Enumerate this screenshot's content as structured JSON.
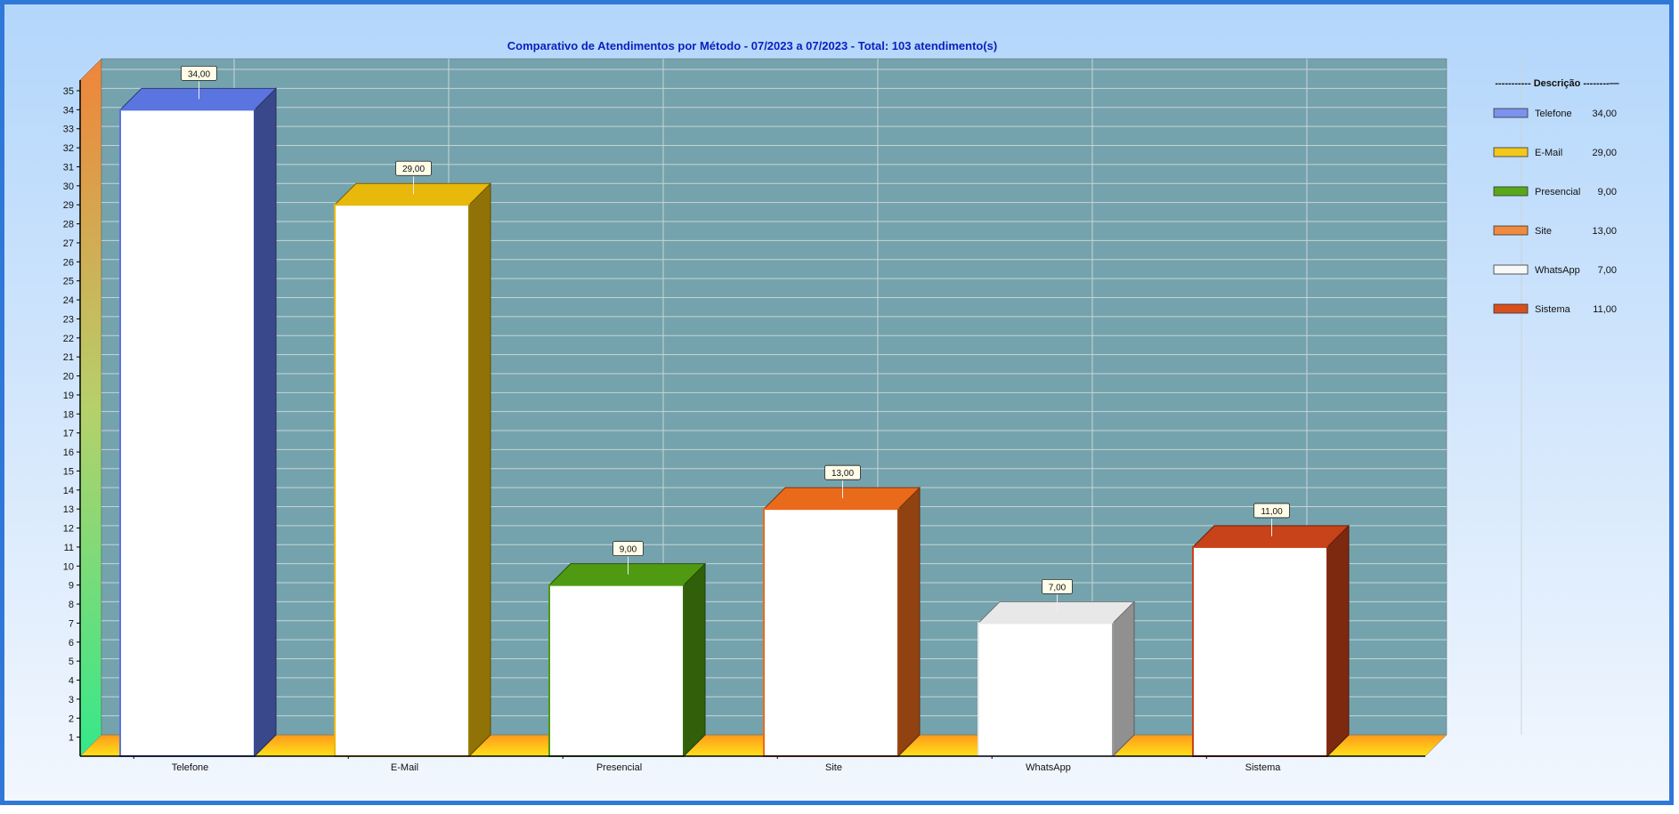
{
  "chart_data": {
    "type": "bar",
    "title": "Comparativo de Atendimentos por Método - 07/2023 a 07/2023 - Total: 103 atendimento(s)",
    "categories": [
      "Telefone",
      "E-Mail",
      "Presencial",
      "Site",
      "WhatsApp",
      "Sistema"
    ],
    "values": [
      34,
      29,
      9,
      13,
      7,
      11
    ],
    "value_labels": [
      "34,00",
      "29,00",
      "9,00",
      "13,00",
      "7,00",
      "11,00"
    ],
    "colors": [
      "#5a74e0",
      "#e8b80a",
      "#4f9a10",
      "#ea6a1c",
      "#e8e8e8",
      "#c8421a"
    ],
    "ylim": [
      0,
      35
    ],
    "yticks": [
      1,
      2,
      3,
      4,
      5,
      6,
      7,
      8,
      9,
      10,
      11,
      12,
      13,
      14,
      15,
      16,
      17,
      18,
      19,
      20,
      21,
      22,
      23,
      24,
      25,
      26,
      27,
      28,
      29,
      30,
      31,
      32,
      33,
      34,
      35
    ],
    "grid": true,
    "legend": {
      "title": "----------- Descrição --------—",
      "placement": "right",
      "entries": [
        {
          "name": "Telefone",
          "value": "34,00",
          "color": "#7b93ee"
        },
        {
          "name": "E-Mail",
          "value": "29,00",
          "color": "#f2c81c"
        },
        {
          "name": "Presencial",
          "value": "9,00",
          "color": "#58a81a"
        },
        {
          "name": "Site",
          "value": "13,00",
          "color": "#f08a3e"
        },
        {
          "name": "WhatsApp",
          "value": "7,00",
          "color": "#f8f8f8"
        },
        {
          "name": "Sistema",
          "value": "11,00",
          "color": "#d8501e"
        }
      ]
    }
  },
  "colors": {
    "frame_border": "#2f78d8",
    "plot_background": "#74a3ad",
    "title_color": "#0a1fbf",
    "floor": "#ffc81a"
  }
}
